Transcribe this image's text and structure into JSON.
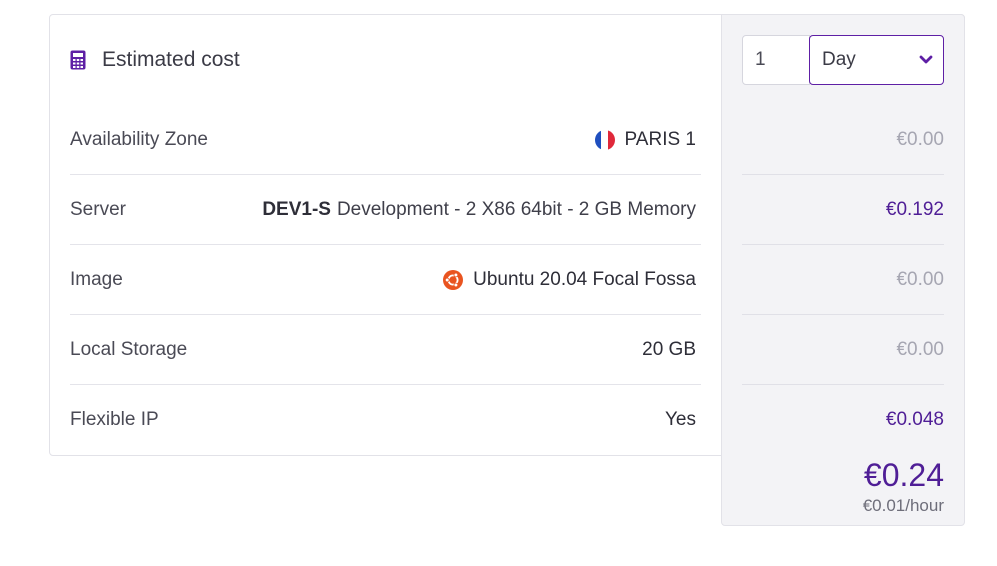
{
  "header": {
    "title": "Estimated cost",
    "icon": "calculator-icon"
  },
  "controls": {
    "quantity": "1",
    "period": "Day",
    "period_icon": "chevron-down-icon"
  },
  "rows": [
    {
      "label": "Availability Zone",
      "value": "PARIS 1",
      "icon": "france-flag-icon",
      "price": "€0.00"
    },
    {
      "label": "Server",
      "value_bold": "DEV1-S",
      "value": "Development - 2 X86 64bit - 2 GB Memory",
      "price": "€0.192"
    },
    {
      "label": "Image",
      "value": "Ubuntu 20.04 Focal Fossa",
      "icon": "ubuntu-icon",
      "price": "€0.00"
    },
    {
      "label": "Local Storage",
      "value": "20 GB",
      "price": "€0.00"
    },
    {
      "label": "Flexible IP",
      "value": "Yes",
      "price": "€0.048"
    }
  ],
  "total": {
    "value": "€0.24",
    "hourly": "€0.01/hour"
  },
  "colors": {
    "accent": "#5e1fa5",
    "price_paid": "#4f1e96",
    "price_zero": "#a6a6b2",
    "panel_bg": "#f3f3f6"
  }
}
